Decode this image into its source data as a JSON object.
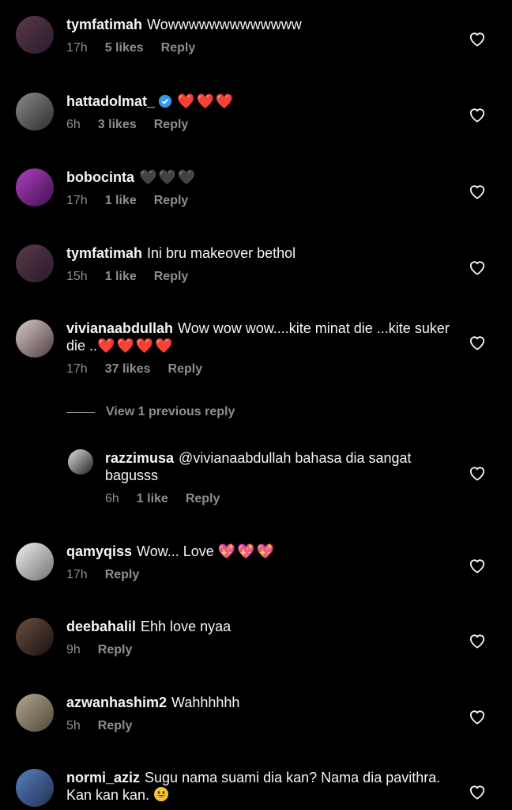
{
  "comments": [
    {
      "user": "tymfatimah",
      "text": "Wowwwwwwwwwwwww",
      "time": "17h",
      "likes": "5 likes",
      "reply": "Reply"
    },
    {
      "user": "hattadolmat_",
      "text": "",
      "hearts": "❤️❤️❤️",
      "time": "6h",
      "likes": "3 likes",
      "reply": "Reply"
    },
    {
      "user": "bobocinta",
      "text": "",
      "hearts": "🖤🖤🖤",
      "time": "17h",
      "likes": "1 like",
      "reply": "Reply"
    },
    {
      "user": "tymfatimah",
      "text": "Ini bru makeover bethol",
      "time": "15h",
      "likes": "1 like",
      "reply": "Reply"
    },
    {
      "user": "vivianaabdullah",
      "text": "Wow wow wow....kite minat die ...kite suker die ..",
      "hearts": "❤️❤️❤️❤️",
      "time": "17h",
      "likes": "37 likes",
      "reply": "Reply"
    },
    {
      "user": "qamyqiss",
      "text": "Wow... Love",
      "hearts": "💖💖💖",
      "time": "17h",
      "reply": "Reply"
    },
    {
      "user": "deebahalil",
      "text": "Ehh love nyaa",
      "time": "9h",
      "reply": "Reply"
    },
    {
      "user": "azwanhashim2",
      "text": "Wahhhhhh",
      "time": "5h",
      "reply": "Reply"
    },
    {
      "user": "normi_aziz",
      "text": "Sugu nama suami dia kan? Nama dia pavithra. Kan kan kan.",
      "time": "",
      "reply": ""
    }
  ],
  "view_replies_label": "View 1 previous reply",
  "reply": {
    "user": "razzimusa",
    "text": "@vivianaabdullah bahasa dia sangat bagusss",
    "time": "6h",
    "likes": "1 like",
    "reply": "Reply"
  }
}
